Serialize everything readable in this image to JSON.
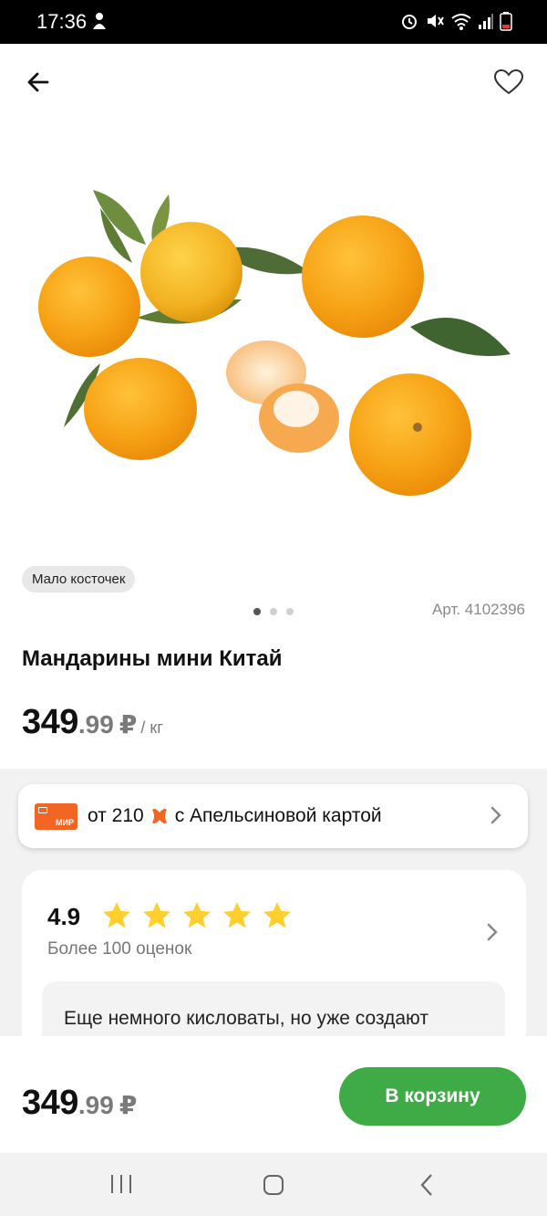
{
  "status_bar": {
    "time": "17:36",
    "icons": [
      "person-icon",
      "alarm-icon",
      "mute-icon",
      "wifi-icon",
      "signal-icon",
      "battery-icon"
    ]
  },
  "header": {
    "back_icon": "arrow-left-icon",
    "favorite_icon": "heart-outline-icon"
  },
  "product": {
    "tag": "Мало косточек",
    "sku": "Арт. 4102396",
    "title": "Мандарины мини Китай",
    "price_int": "349",
    "price_dec": ".99",
    "currency": "₽",
    "unit": "/ кг",
    "carousel": {
      "count": 3,
      "active": 0
    }
  },
  "offer": {
    "card_brand": "МИР",
    "text_prefix": "от 210",
    "text_suffix": "с Апельсиновой картой",
    "accent": "#f26522"
  },
  "rating": {
    "value": "4.9",
    "stars": 5,
    "count_text": "Более 100 оценок",
    "review_text": "Еще немного кисловаты, но уже создают"
  },
  "bottom_bar": {
    "price_int": "349",
    "price_dec": ".99",
    "currency": "₽",
    "cart_label": "В корзину",
    "accent": "#3fab46"
  },
  "nav": {
    "icons": [
      "recents-icon",
      "home-icon",
      "back-icon"
    ]
  }
}
